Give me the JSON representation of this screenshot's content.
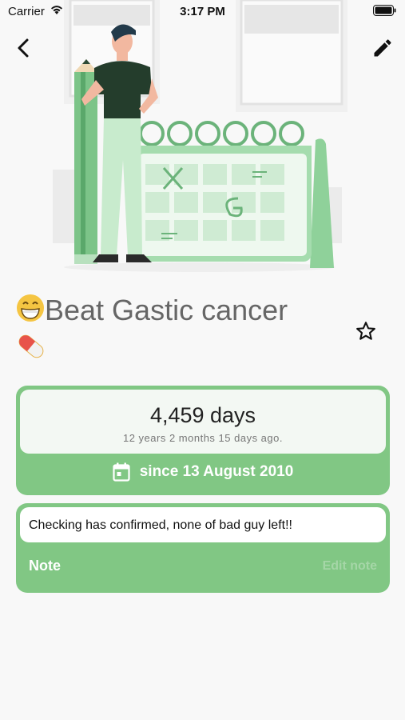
{
  "status_bar": {
    "carrier": "Carrier",
    "time": "3:17 PM"
  },
  "nav": {
    "back_icon": "chevron-left-icon",
    "edit_icon": "pencil-icon"
  },
  "illustration": "person-with-pencil-and-calendar-illustration",
  "goal": {
    "title": "Beat Gastic cancer",
    "leading_emoji": "😁",
    "trailing_emoji": "💊",
    "favorite_icon": "star-outline-icon"
  },
  "counter": {
    "days": "4,459 days",
    "elapsed": "12 years 2 months 15 days ago.",
    "since": "since 13 August 2010",
    "calendar_icon": "calendar-icon"
  },
  "note": {
    "text": "Checking has confirmed, none of bad guy left!!",
    "label": "Note",
    "edit_label": "Edit note"
  },
  "colors": {
    "accent": "#81c784",
    "accent_light": "#a5d6a7",
    "card_inner": "#f3f8f3",
    "background": "#f8f8f8"
  }
}
